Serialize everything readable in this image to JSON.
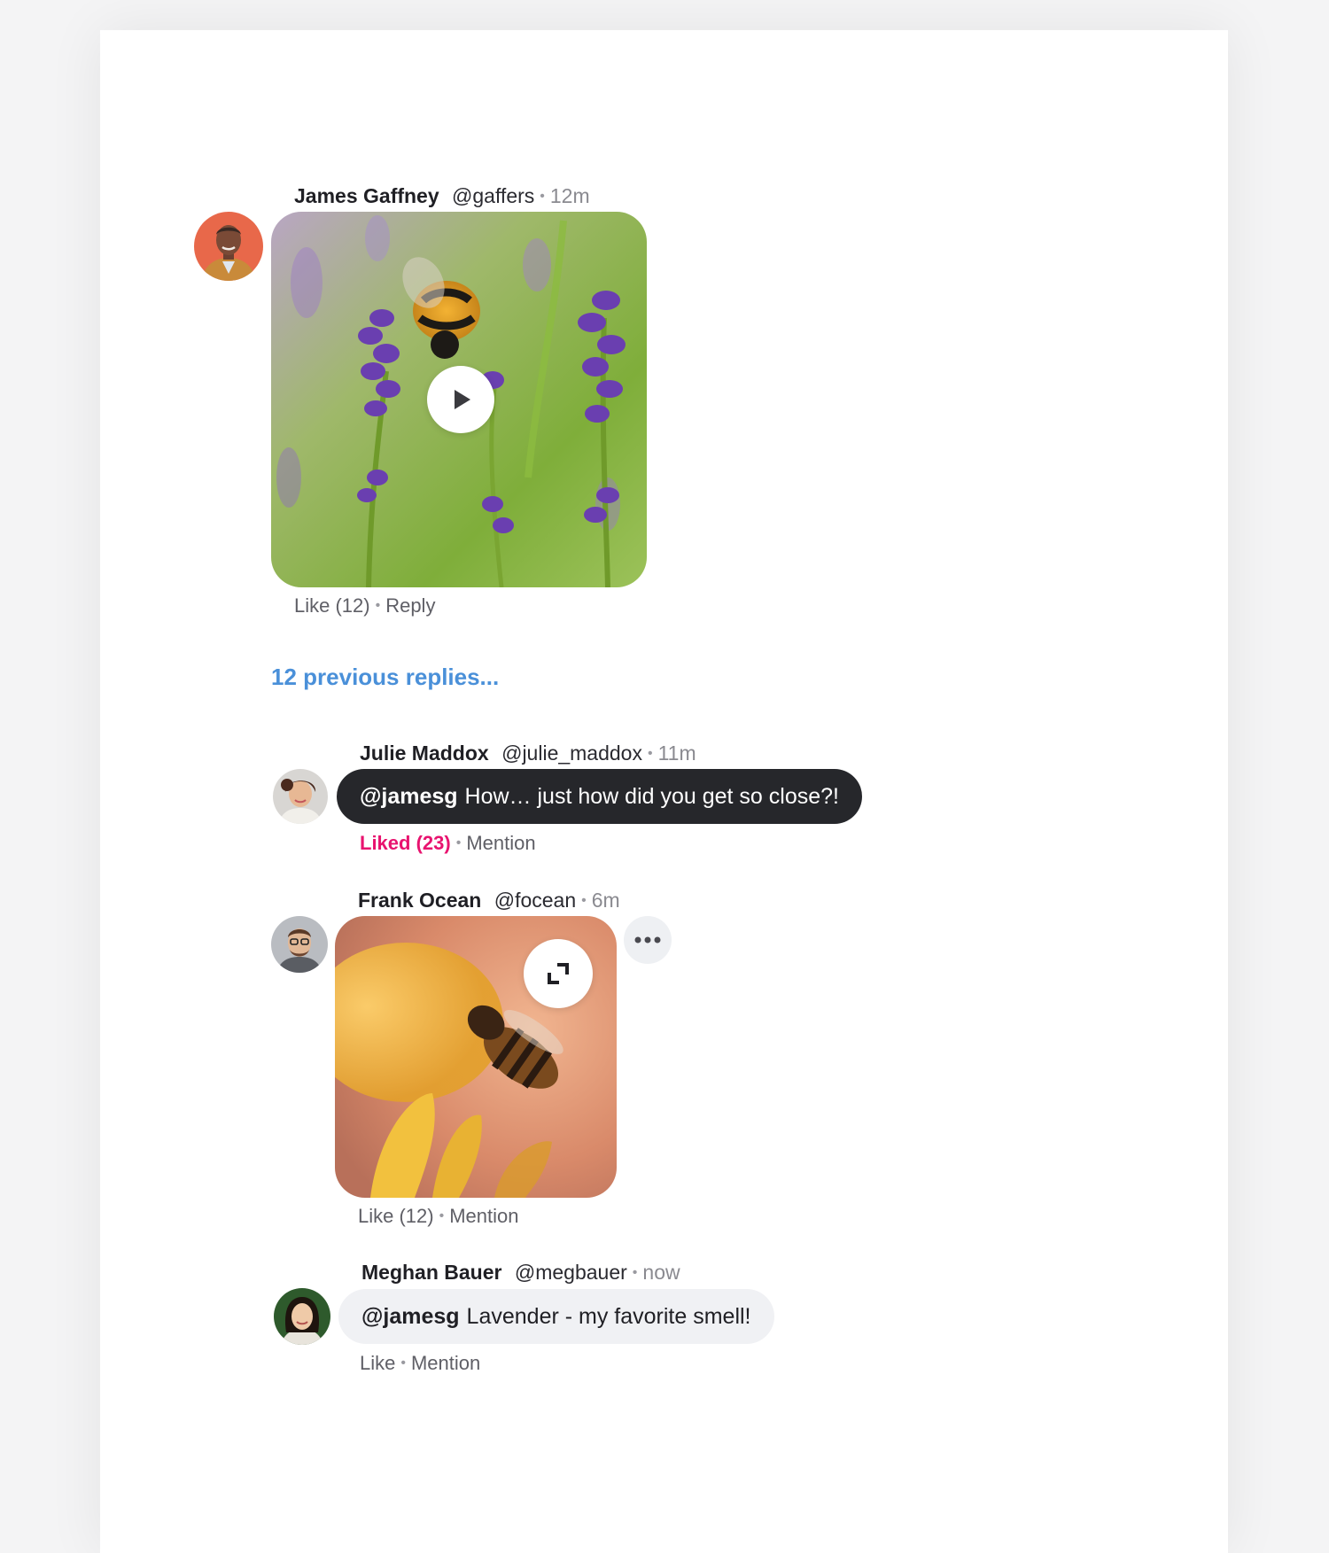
{
  "thread": {
    "previous_replies_label": "12 previous replies...",
    "separator": "•",
    "posts": [
      {
        "author": "James Gaffney",
        "handle": "@gaffers",
        "time": "12m",
        "media_type": "video",
        "actions": {
          "like": "Like (12)",
          "secondary": "Reply"
        }
      },
      {
        "author": "Julie Maddox",
        "handle": "@julie_maddox",
        "time": "11m",
        "mention": "@jamesg",
        "text": "How… just how did you get so close?!",
        "actions": {
          "like": "Liked (23)",
          "secondary": "Mention"
        }
      },
      {
        "author": "Frank Ocean",
        "handle": "@focean",
        "time": "6m",
        "media_type": "image",
        "actions": {
          "like": "Like (12)",
          "secondary": "Mention"
        }
      },
      {
        "author": "Meghan Bauer",
        "handle": "@megbauer",
        "time": "now",
        "mention": "@jamesg",
        "text": "Lavender - my favorite smell!",
        "actions": {
          "like": "Like",
          "secondary": "Mention"
        }
      }
    ]
  },
  "colors": {
    "link": "#4a90d9",
    "liked": "#e8136f",
    "dark_bubble": "#26272b",
    "light_bubble": "#f0f1f4"
  },
  "icons": [
    "play-icon",
    "expand-icon",
    "more-options-icon"
  ]
}
